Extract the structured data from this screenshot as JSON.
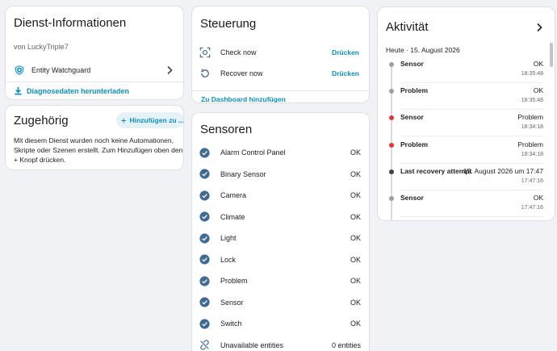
{
  "service_info": {
    "title": "Dienst-Informationen",
    "by": "von LuckyTriple7",
    "entity_label": "Entity Watchguard",
    "download_label": "Diagnosedaten herunterladen"
  },
  "related": {
    "title": "Zugehörig",
    "add_label": "Hinzufügen zu ...",
    "text": "Mit diesem Dienst wurden noch keine Automationen, Skripte oder Szenen erstellt. Zum Hinzufügen oben den + Knopf drücken."
  },
  "controls": {
    "title": "Steuerung",
    "items": [
      {
        "label": "Check now",
        "action": "Drücken",
        "icon": "scan-icon"
      },
      {
        "label": "Recover now",
        "action": "Drücken",
        "icon": "restore-icon"
      }
    ],
    "dashboard_label": "Zu Dashboard hinzufügen"
  },
  "sensors": {
    "title": "Sensoren",
    "items": [
      {
        "label": "Alarm Control Panel",
        "value": "OK"
      },
      {
        "label": "Binary Sensor",
        "value": "OK"
      },
      {
        "label": "Camera",
        "value": "OK"
      },
      {
        "label": "Climate",
        "value": "OK"
      },
      {
        "label": "Light",
        "value": "OK"
      },
      {
        "label": "Lock",
        "value": "OK"
      },
      {
        "label": "Problem",
        "value": "OK"
      },
      {
        "label": "Sensor",
        "value": "OK"
      },
      {
        "label": "Switch",
        "value": "OK"
      },
      {
        "label": "Unavailable entities",
        "value": "0 entities"
      }
    ]
  },
  "activity": {
    "title": "Aktivität",
    "date": "Heute · 15. August 2026",
    "items": [
      {
        "name": "Sensor",
        "state": "OK",
        "time": "18:35:48",
        "dot": "#9e9e9e"
      },
      {
        "name": "Problem",
        "state": "OK",
        "time": "18:35:48",
        "dot": "#9e9e9e"
      },
      {
        "name": "Sensor",
        "state": "Problem",
        "time": "18:34:18",
        "dot": "#e53935"
      },
      {
        "name": "Problem",
        "state": "Problem",
        "time": "18:34:18",
        "dot": "#e53935"
      },
      {
        "name": "Last recovery attempt",
        "state": "15. August 2026 um 17:47",
        "time": "17:47:16",
        "dot": "#424242"
      },
      {
        "name": "Sensor",
        "state": "OK",
        "time": "17:47:16",
        "dot": "#9e9e9e"
      }
    ]
  },
  "colors": {
    "accent": "#0f8fbd",
    "check_circle": "#3f6a96",
    "problem": "#e53935"
  }
}
